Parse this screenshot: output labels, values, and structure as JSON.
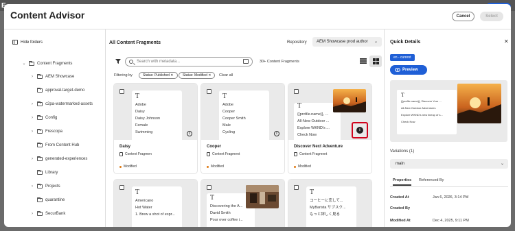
{
  "app": {
    "title": "Content Advisor",
    "cancel_label": "Cancel",
    "select_label": "Select"
  },
  "sidebar": {
    "hide_folders": "Hide folders",
    "items": [
      {
        "label": "Content Fragments",
        "chevron": "⌄"
      },
      {
        "label": "AEM Showcase",
        "chevron": "›"
      },
      {
        "label": "approval-target-demo",
        "chevron": ""
      },
      {
        "label": "c2pa-watermarked-assets",
        "chevron": "›"
      },
      {
        "label": "Config",
        "chevron": "›"
      },
      {
        "label": "Frescopa",
        "chevron": "›"
      },
      {
        "label": "From Content Hub",
        "chevron": ""
      },
      {
        "label": "generated-experiences",
        "chevron": "›"
      },
      {
        "label": "Library",
        "chevron": ""
      },
      {
        "label": "Projects",
        "chevron": "›"
      },
      {
        "label": "quarantine",
        "chevron": ""
      },
      {
        "label": "SecurBank",
        "chevron": "›"
      }
    ]
  },
  "main": {
    "title": "All Content Fragments",
    "repository_label": "Repository",
    "repository_value": "AEM Showcase prod author",
    "search_placeholder": "Search with metadata...",
    "result_count": "30+ Content Fragments",
    "filtering_by": "Filtering by",
    "chips": [
      "Status: Published ✕",
      "Status: Modified ✕"
    ],
    "clear_all": "Clear all",
    "cards": [
      {
        "name": "Daisy",
        "type": "Content Fragmen",
        "status": "Modified",
        "T": "T",
        "lines": [
          "Adobe",
          "Daisy",
          "Daisy Johnson",
          "Female",
          "Swimming"
        ]
      },
      {
        "name": "Cooper",
        "type": "Content Fragment",
        "status": "Modified",
        "T": "T",
        "lines": [
          "Adobe",
          "Cooper",
          "Cooper Smith",
          "Male",
          "Cycling"
        ]
      },
      {
        "name": "Discover Next Adventure",
        "type": "Content Fragment",
        "status": "Modified",
        "T": "T",
        "lines": [
          "{{profile.name}}, ...",
          "All-New Outdoor ...",
          "Explore WKND's ...",
          "Check Now"
        ]
      },
      {
        "name": "",
        "type": "",
        "status": "",
        "T": "T",
        "lines": [
          "Americano",
          "Hot Water",
          "1. Brew a shot of espr..."
        ]
      },
      {
        "name": "",
        "type": "",
        "status": "",
        "T": "T",
        "lines": [
          "Discovering the A...",
          "David Smith",
          "Pour over coffee i..."
        ]
      },
      {
        "name": "",
        "type": "",
        "status": "",
        "T": "T",
        "lines": [
          "コーヒーに恋して...",
          "MyBarista サブスク...",
          "もっと詳しく見る"
        ]
      }
    ]
  },
  "details": {
    "title": "Quick Details",
    "close": "✕",
    "badge": "en - current",
    "preview_label": "Preview",
    "preview_T": "T",
    "preview_lines": [
      "{{profile.name}}, Discover Your ...",
      "All-New Outdoor Adventures",
      "Explore WKND's new lineup of s...",
      "Check Now"
    ],
    "variations_label": "Variations  (1)",
    "variation_value": "main",
    "tabs": [
      "Properties",
      "Referenced By"
    ],
    "properties": [
      {
        "key": "Created At",
        "value": "Jan 6, 2026, 3:14 PM"
      },
      {
        "key": "Created By",
        "value": ""
      },
      {
        "key": "Modified At",
        "value": "Dec 4, 2025, 9:11 PM"
      }
    ]
  },
  "colors": {
    "accent": "#1f5fd6",
    "status_modified": "#e07a14",
    "highlight_outline": "#d0021b"
  }
}
